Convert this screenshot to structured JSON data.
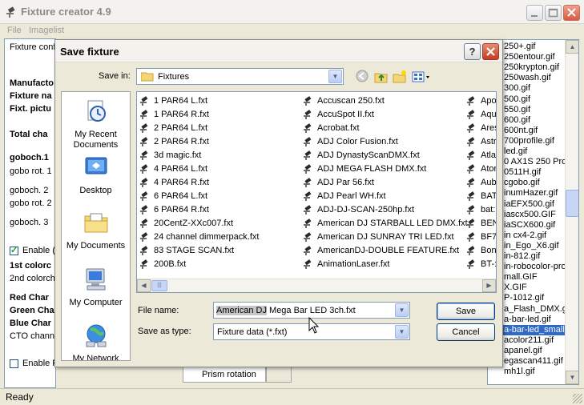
{
  "app": {
    "title": "Fixture creator 4.9",
    "menu": [
      "File",
      "Imagelist"
    ],
    "status": "Ready"
  },
  "left_panel": {
    "fixture_conf": "Fixture conf",
    "manufacturer": "Manufacto",
    "fixture_name": "Fixture na",
    "fixt_picture": "Fixt. pictu",
    "total_channels": "Total cha",
    "goboch1": "goboch.1",
    "gobo_rot1": "gobo rot. 1",
    "goboch2": "goboch. 2",
    "gobo_rot2": "gobo rot. 2",
    "goboch3": "goboch. 3",
    "enable1": "Enable (",
    "colorch1": "1st colorc",
    "colorch2": "2nd colorch",
    "red": "Red Char",
    "green": "Green Cha",
    "blue": "Blue Char",
    "cto": "CTO chann",
    "enable2": "Enable F"
  },
  "prism_rotation": "Prism rotation",
  "imagelist": [
    "250+.gif",
    "250entour.gif",
    "250krypton.gif",
    "250wash.gif",
    "300.gif",
    "500.gif",
    "550.gif",
    "600.gif",
    "600nt.gif",
    "700profile.gif",
    "led.gif",
    "0 AX1S 250 Pro",
    "0511H.gif",
    "cgobo.gif",
    "inumHazer.gif",
    "iaEFX500.gif",
    "iascx500.GIF",
    "iaSCX600.gif",
    "in cx4-2.gif",
    "in_Ego_X6.gif",
    "in-812.gif",
    "in-robocolor-pro-",
    "mall.GIF",
    "X.GIF",
    "P-1012.gif",
    "a_Flash_DMX.gi",
    "a-bar-led.gif",
    "a-bar-led_small.g",
    "acolor211.gif",
    "apanel.gif",
    "egascan411.gif",
    "mh1l.gif"
  ],
  "imagelist_selected": "a-bar-led_small.g",
  "dialog": {
    "title": "Save fixture",
    "save_in_label": "Save in:",
    "save_in_value": "Fixtures",
    "places": [
      "My Recent Documents",
      "Desktop",
      "My Documents",
      "My Computer",
      "My Network"
    ],
    "files_col1": [
      "1 PAR64 L.fxt",
      "1 PAR64 R.fxt",
      "2 PAR64 L.fxt",
      "2 PAR64 R.fxt",
      "3d magic.fxt",
      "4 PAR64 L.fxt",
      "4 PAR64 R.fxt",
      "6 PAR64 L.fxt",
      "6 PAR64 R.fxt",
      "20CentZ-XXc007.fxt",
      "24 channel dimmerpack.fxt",
      "83 STAGE SCAN.fxt",
      "200B.fxt"
    ],
    "files_col2": [
      "Accuscan 250.fxt",
      "AccuSpot II.fxt",
      "Acrobat.fxt",
      "ADJ Color Fusion.fxt",
      "ADJ DynastyScanDMX.fxt",
      "ADJ MEGA FLASH DMX.fxt",
      "ADJ Par 56.fxt",
      "ADJ Pearl WH.fxt",
      "ADJ-DJ-SCAN-250hp.fxt",
      "American DJ STARBALL LED DMX.fxt",
      "American DJ SUNRAY TRI LED.fxt",
      "AmericanDJ-DOUBLE FEATURE.fxt",
      "AnimationLaser.fxt"
    ],
    "files_col3": [
      "Apo",
      "Aqu",
      "Ares",
      "Astr",
      "Atla",
      "Ator",
      "Aub",
      "BAT",
      "bat:",
      "BEN",
      "BF7",
      "Bon",
      "BT-:"
    ],
    "file_name_label": "File name:",
    "file_name_selected": "American DJ",
    "file_name_rest": " Mega Bar LED 3ch.fxt",
    "save_as_type_label": "Save as type:",
    "save_as_type_value": "Fixture data (*.fxt)",
    "save_button": "Save",
    "cancel_button": "Cancel"
  }
}
